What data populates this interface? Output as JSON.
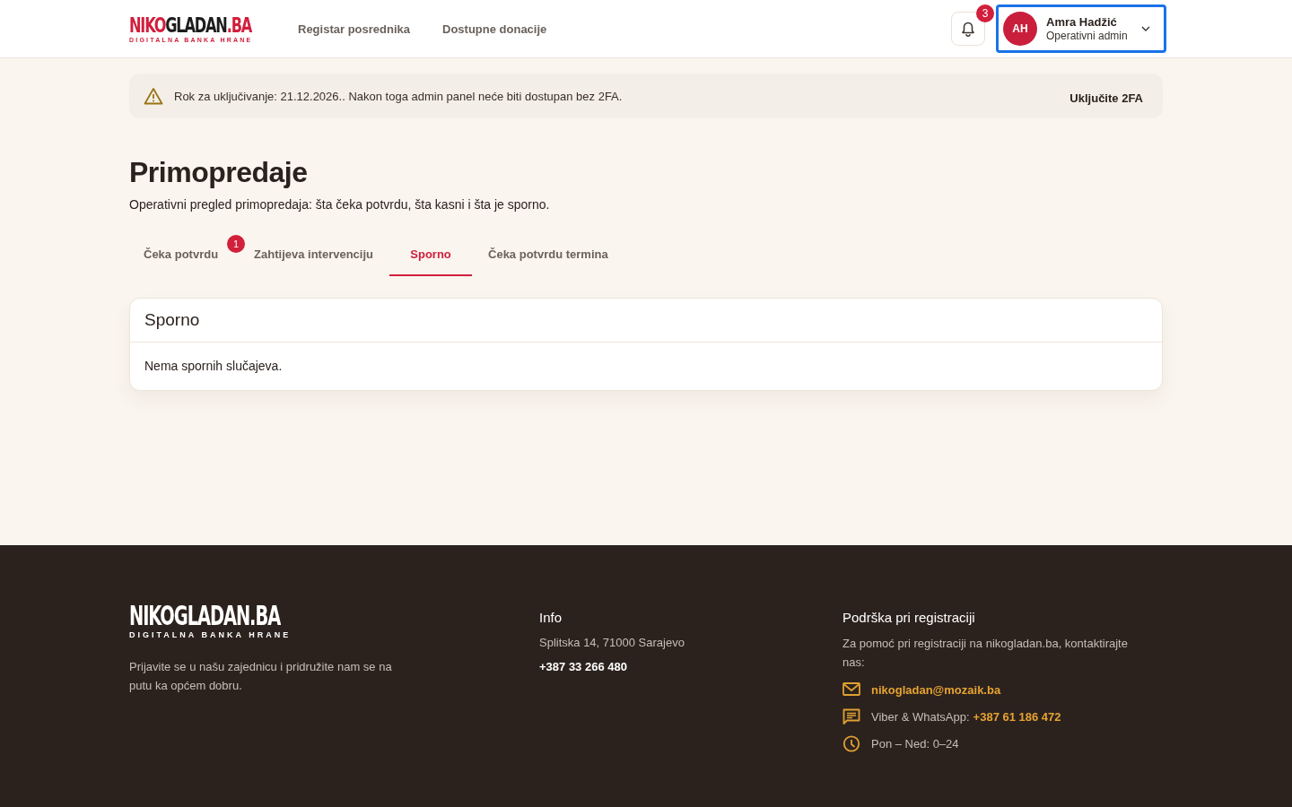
{
  "header": {
    "logo": {
      "parts": [
        {
          "text": "NIKO",
          "accent": true
        },
        {
          "text": "GLADAN",
          "accent": false
        },
        {
          "text": ".BA",
          "accent": true
        }
      ],
      "tagline": "DIGITALNA BANKA HRANE"
    },
    "nav": [
      {
        "label": "Registar posrednika"
      },
      {
        "label": "Dostupne donacije"
      }
    ],
    "notifications": {
      "count": "3"
    },
    "user": {
      "initials": "AH",
      "name": "Amra Hadžić",
      "role": "Operativni admin",
      "focused": true
    }
  },
  "alert": {
    "message": "Rok za uključivanje: 21.12.2026.. Nakon toga admin panel neće biti dostupan bez 2FA.",
    "action": "Uključite 2FA"
  },
  "page": {
    "title": "Primopredaje",
    "subtitle": "Operativni pregled primopredaja: šta čeka potvrdu, šta kasni i šta je sporno."
  },
  "tabs": [
    {
      "label": "Čeka potvrdu",
      "selected": false,
      "badge": "1"
    },
    {
      "label": "Zahtijeva intervenciju",
      "selected": false
    },
    {
      "label": "Sporno",
      "selected": true
    },
    {
      "label": "Čeka potvrdu termina",
      "selected": false
    }
  ],
  "panel": {
    "title": "Sporno",
    "empty_message": "Nema spornih slučajeva."
  },
  "footer": {
    "logo": {
      "name": "NIKOGLADAN.BA",
      "tagline": "DIGITALNA BANKA HRANE"
    },
    "about": "Prijavite se u našu zajednicu i pridružite nam se na putu ka općem dobru.",
    "info": {
      "title": "Info",
      "address": "Splitska 14, 71000 Sarajevo",
      "phone": "+387 33 266 480"
    },
    "support": {
      "title": "Podrška pri registraciji",
      "text": "Za pomoć pri registraciji na nikogladan.ba, kontaktirajte nas:",
      "contacts": [
        {
          "kind": "email",
          "link": "nikogladan@mozaik.ba"
        },
        {
          "kind": "message",
          "text": "Viber & WhatsApp:",
          "link": "+387 61 186 472"
        },
        {
          "kind": "hours",
          "text": "Pon – Ned: 0–24"
        }
      ]
    }
  }
}
